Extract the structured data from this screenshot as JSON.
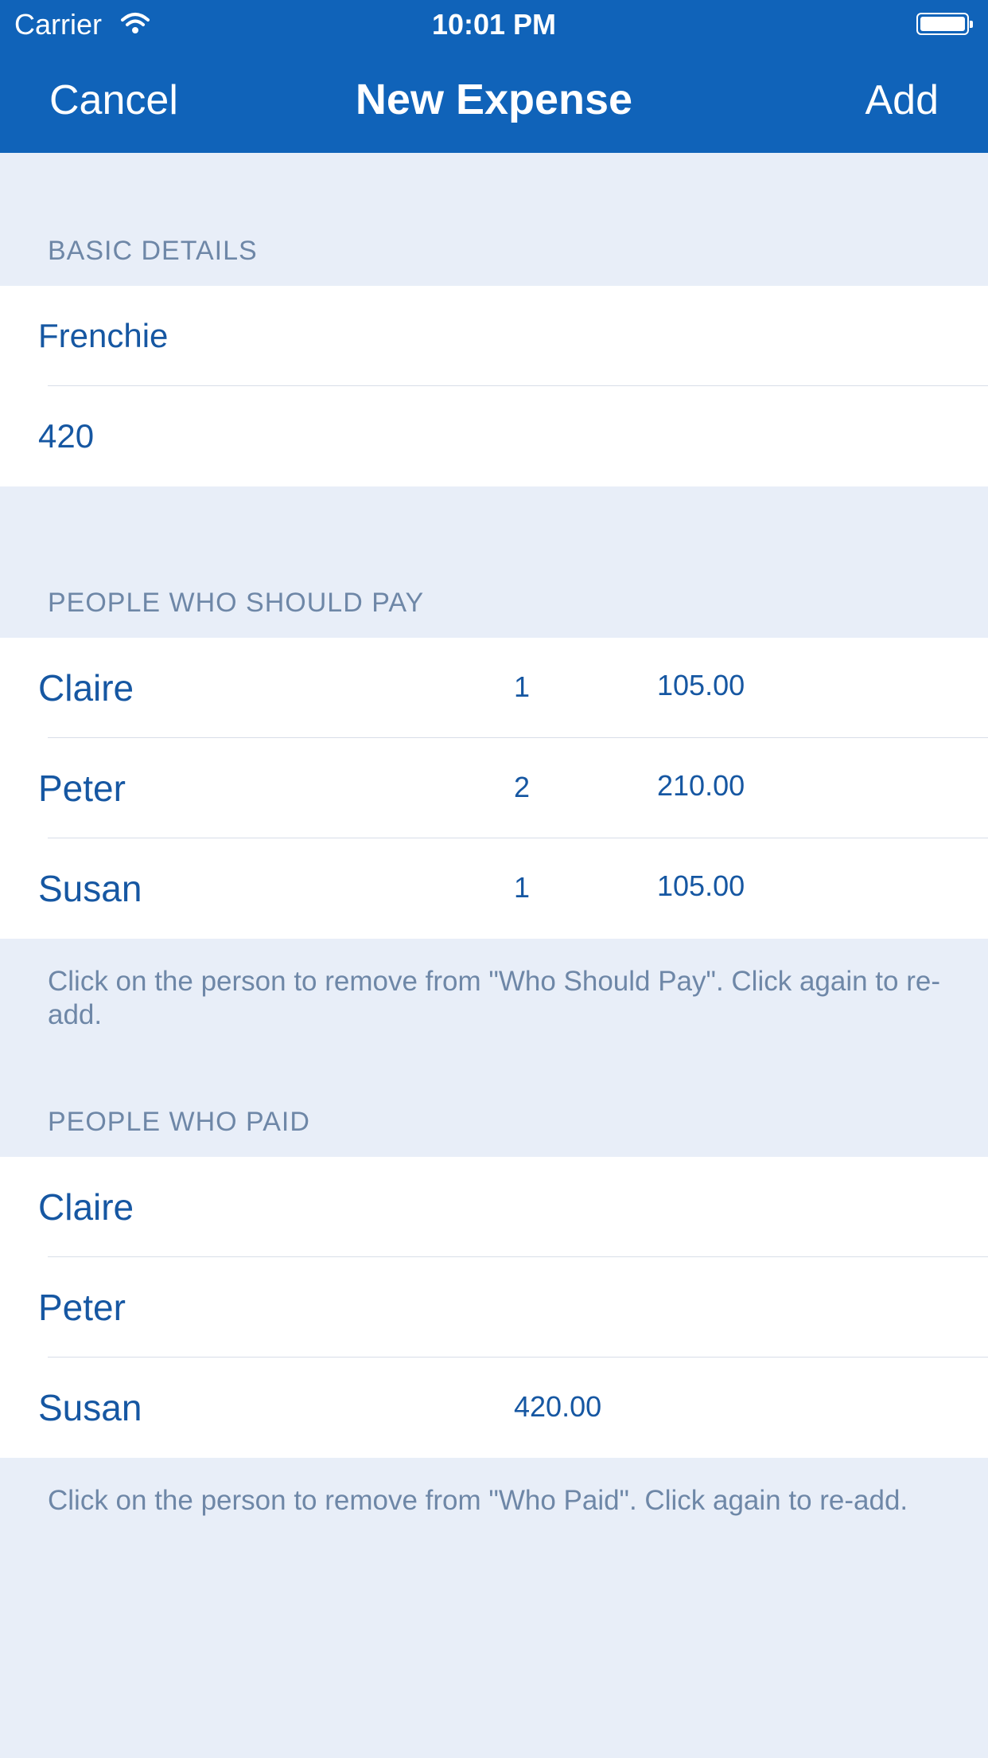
{
  "status_bar": {
    "carrier": "Carrier",
    "time": "10:01 PM"
  },
  "nav": {
    "cancel_label": "Cancel",
    "title": "New Expense",
    "add_label": "Add"
  },
  "basic_details": {
    "header": "BASIC DETAILS",
    "description_value": "Frenchie",
    "amount_value": "420"
  },
  "should_pay": {
    "header": "PEOPLE WHO SHOULD PAY",
    "rows": [
      {
        "name": "Claire",
        "shares": "1",
        "amount": "105.00"
      },
      {
        "name": "Peter",
        "shares": "2",
        "amount": "210.00"
      },
      {
        "name": "Susan",
        "shares": "1",
        "amount": "105.00"
      }
    ],
    "footer": "Click on the person to remove from \"Who Should Pay\". Click again to re-add."
  },
  "paid": {
    "header": "PEOPLE WHO PAID",
    "rows": [
      {
        "name": "Claire",
        "amount": ""
      },
      {
        "name": "Peter",
        "amount": ""
      },
      {
        "name": "Susan",
        "amount": "420.00"
      }
    ],
    "footer": "Click on the person to remove from \"Who Paid\". Click again to re-add."
  },
  "colors": {
    "nav_background": "#1063b9",
    "page_background": "#e8eef8",
    "text_blue": "#1657a2",
    "muted_text": "#6e87a7"
  },
  "icons": {
    "wifi": "wifi-icon",
    "battery": "battery-icon"
  }
}
